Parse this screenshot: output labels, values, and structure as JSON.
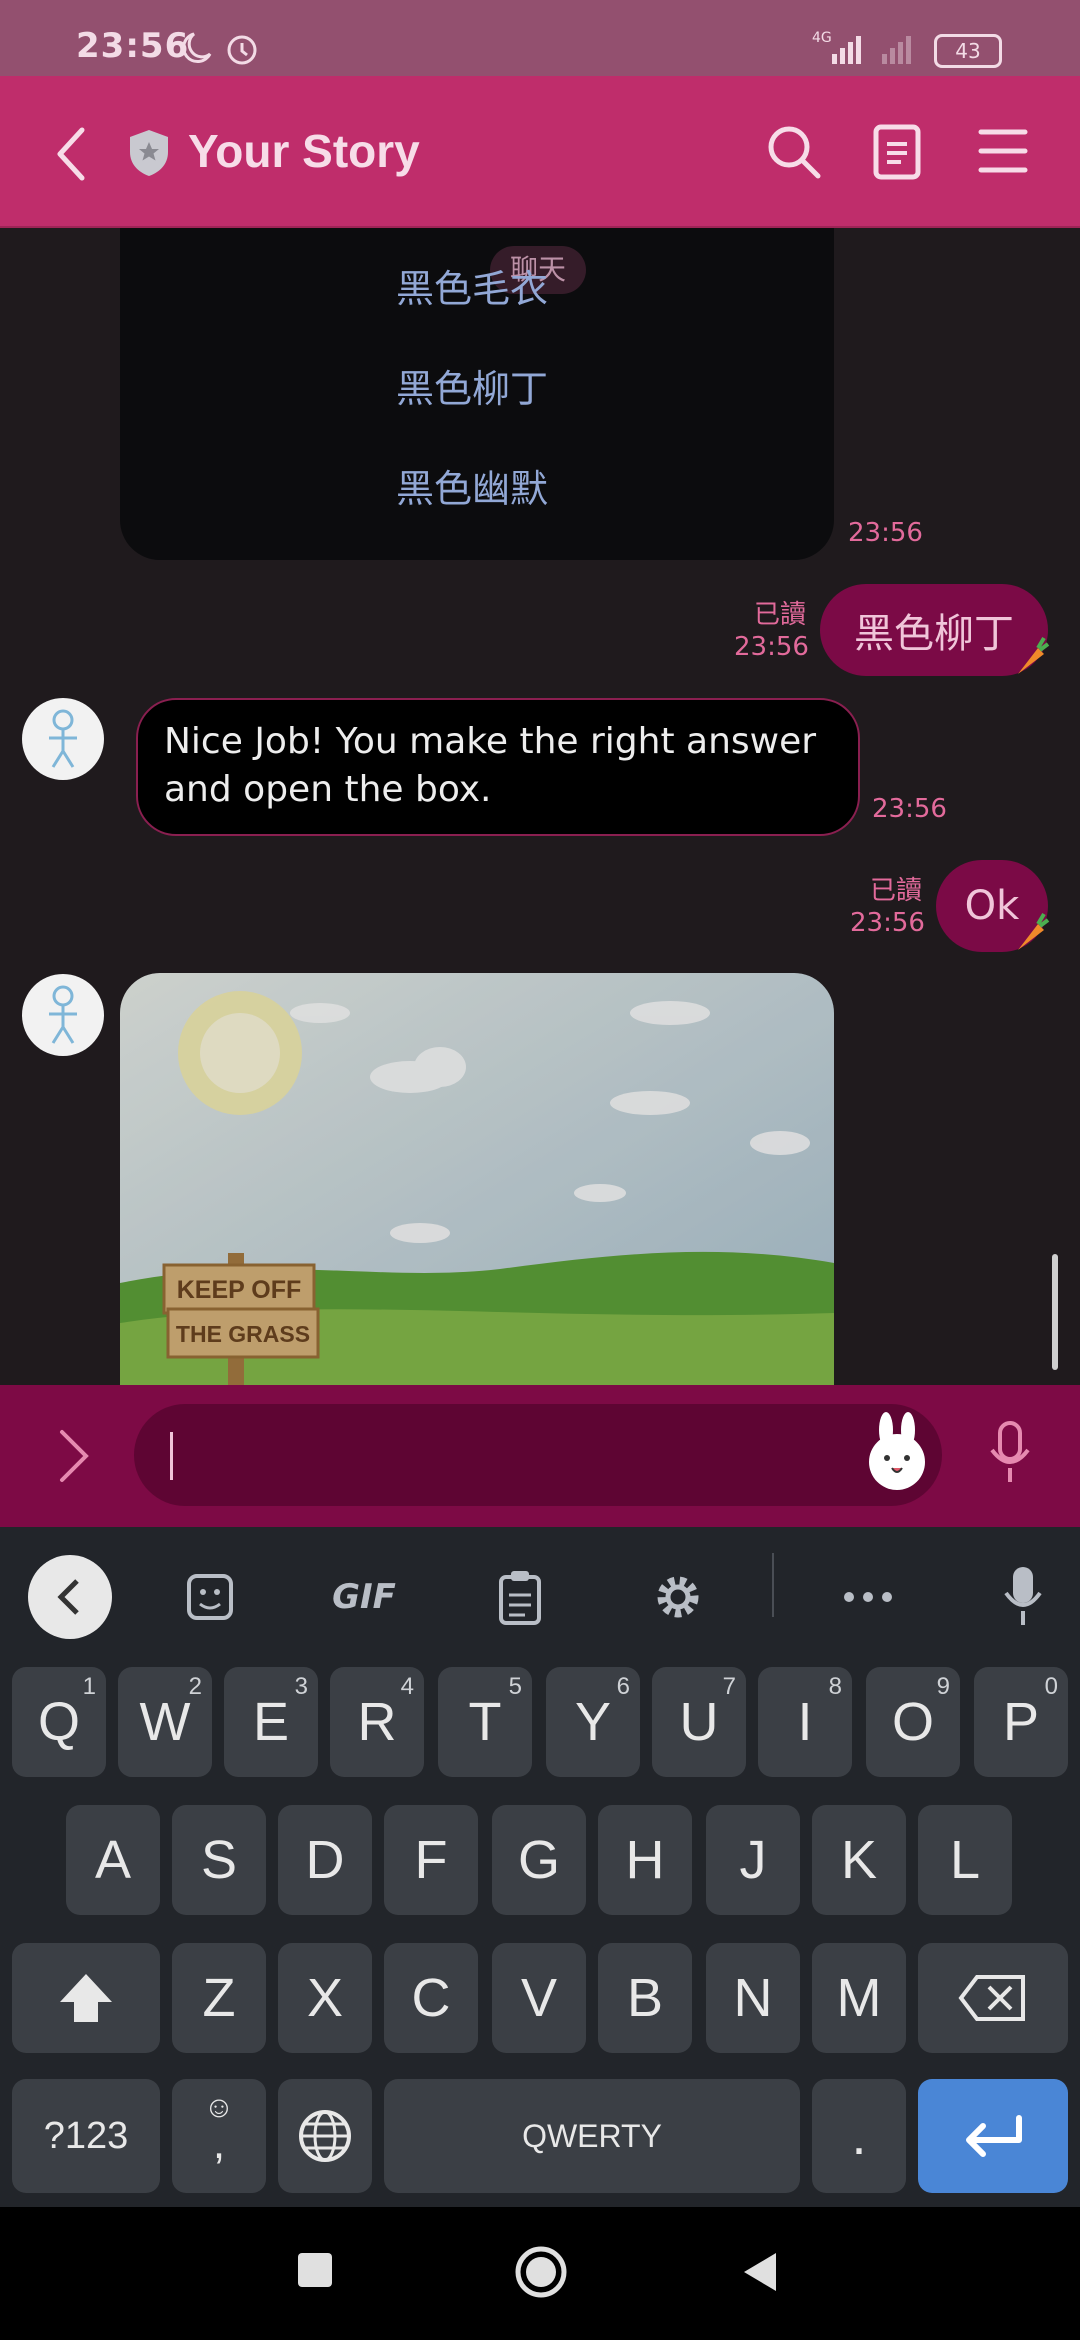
{
  "status_bar": {
    "time": "23:56",
    "network": "4G",
    "battery": "43"
  },
  "header": {
    "title": "Your Story"
  },
  "chat": {
    "menu_options": [
      "黑色毛衣",
      "黑色柳丁",
      "黑色幽默"
    ],
    "menu_overlay_text": "聊天",
    "menu_time": "23:56",
    "messages": [
      {
        "type": "outgoing",
        "text": "黑色柳丁",
        "read_label": "已讀",
        "time": "23:56"
      },
      {
        "type": "incoming",
        "text": "Nice Job! You make the right answer and open the box.",
        "time": "23:56"
      },
      {
        "type": "outgoing",
        "text": "Ok",
        "read_label": "已讀",
        "time": "23:56"
      },
      {
        "type": "incoming_image",
        "sign_line1": "KEEP OFF",
        "sign_line2": "THE GRASS"
      }
    ]
  },
  "keyboard": {
    "row1": [
      {
        "k": "Q",
        "n": "1"
      },
      {
        "k": "W",
        "n": "2"
      },
      {
        "k": "E",
        "n": "3"
      },
      {
        "k": "R",
        "n": "4"
      },
      {
        "k": "T",
        "n": "5"
      },
      {
        "k": "Y",
        "n": "6"
      },
      {
        "k": "U",
        "n": "7"
      },
      {
        "k": "I",
        "n": "8"
      },
      {
        "k": "O",
        "n": "9"
      },
      {
        "k": "P",
        "n": "0"
      }
    ],
    "row2": [
      "A",
      "S",
      "D",
      "F",
      "G",
      "H",
      "J",
      "K",
      "L"
    ],
    "row3": [
      "Z",
      "X",
      "C",
      "V",
      "B",
      "N",
      "M"
    ],
    "symbols_label": "?123",
    "comma_label": ",",
    "space_label": "QWERTY",
    "period_label": ".",
    "gif_label": "GIF"
  },
  "colors": {
    "header": "#bf2d6b",
    "bubble_out": "#7b0a46",
    "enter_key": "#4a86d6"
  }
}
